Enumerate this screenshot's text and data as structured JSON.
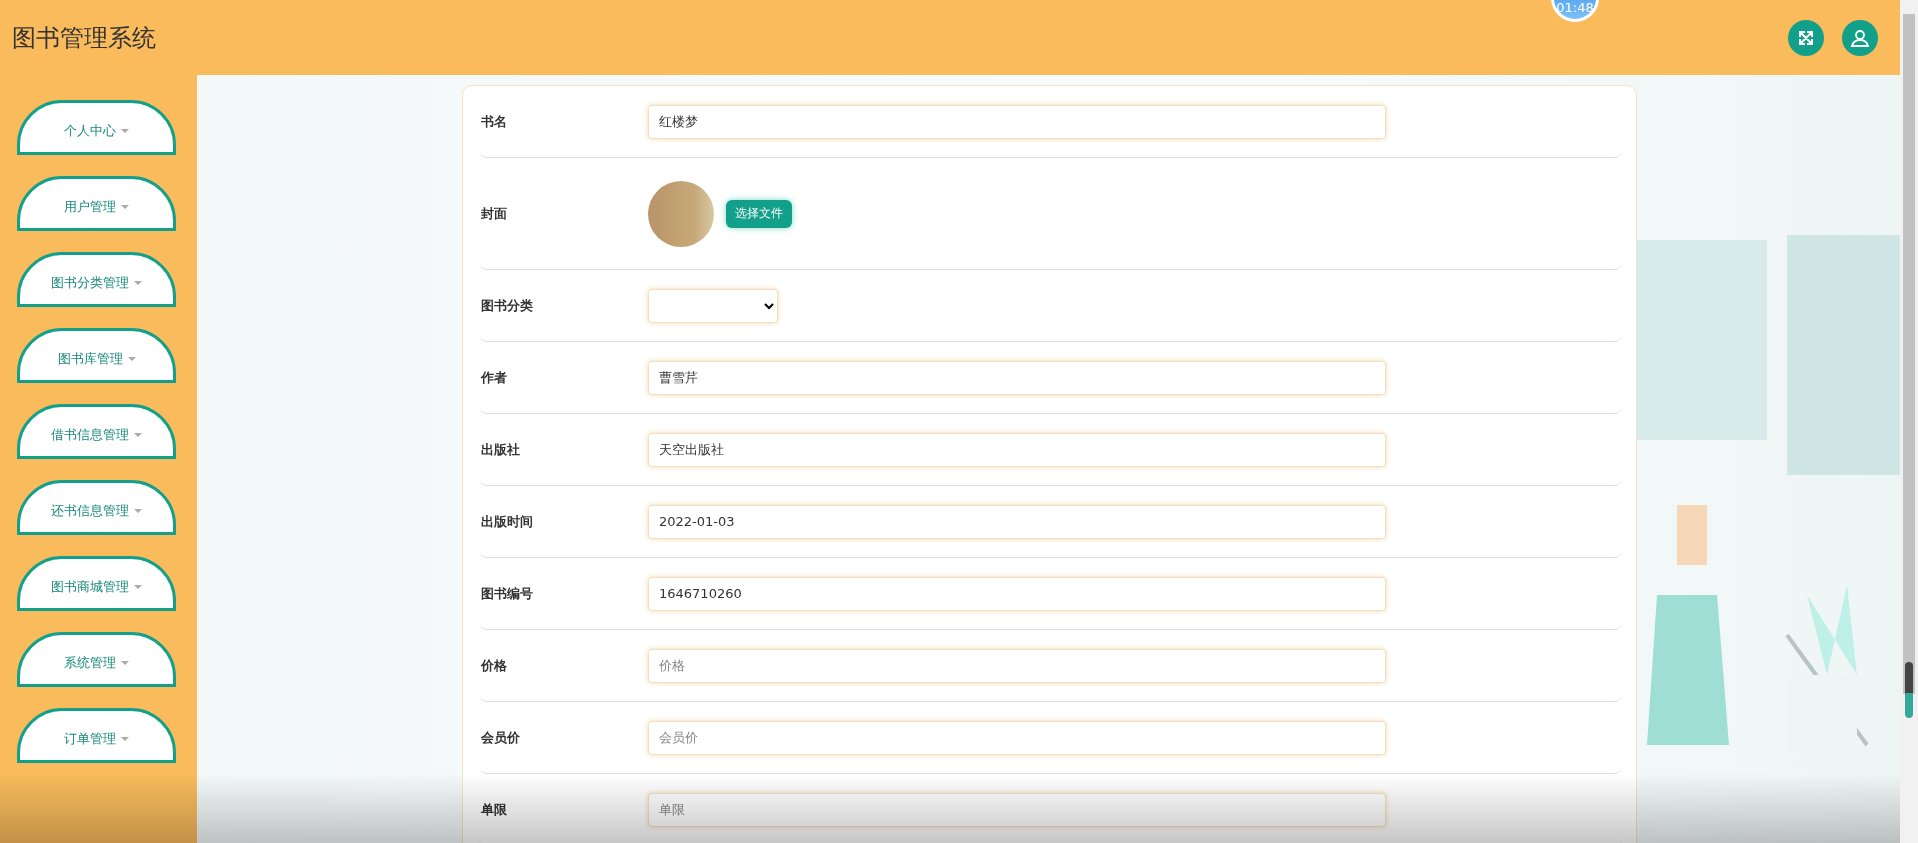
{
  "header": {
    "title": "图书管理系统",
    "timer": "01:48"
  },
  "sidebar": {
    "items": [
      {
        "label": "个人中心"
      },
      {
        "label": "用户管理"
      },
      {
        "label": "图书分类管理"
      },
      {
        "label": "图书库管理"
      },
      {
        "label": "借书信息管理"
      },
      {
        "label": "还书信息管理"
      },
      {
        "label": "图书商城管理"
      },
      {
        "label": "系统管理"
      },
      {
        "label": "订单管理"
      }
    ]
  },
  "form": {
    "fields": [
      {
        "kind": "text",
        "label": "书名",
        "value": "红楼梦"
      },
      {
        "kind": "image",
        "label": "封面",
        "button": "选择文件"
      },
      {
        "kind": "select",
        "label": "图书分类"
      },
      {
        "kind": "text",
        "label": "作者",
        "value": "曹雪芹"
      },
      {
        "kind": "text",
        "label": "出版社",
        "value": "天空出版社"
      },
      {
        "kind": "text",
        "label": "出版时间",
        "value": "2022-01-03"
      },
      {
        "kind": "text",
        "label": "图书编号",
        "value": "1646710260"
      },
      {
        "kind": "text",
        "label": "价格",
        "placeholder": "价格"
      },
      {
        "kind": "text",
        "label": "会员价",
        "placeholder": "会员价"
      },
      {
        "kind": "text",
        "label": "单限",
        "placeholder": "单限"
      }
    ]
  }
}
